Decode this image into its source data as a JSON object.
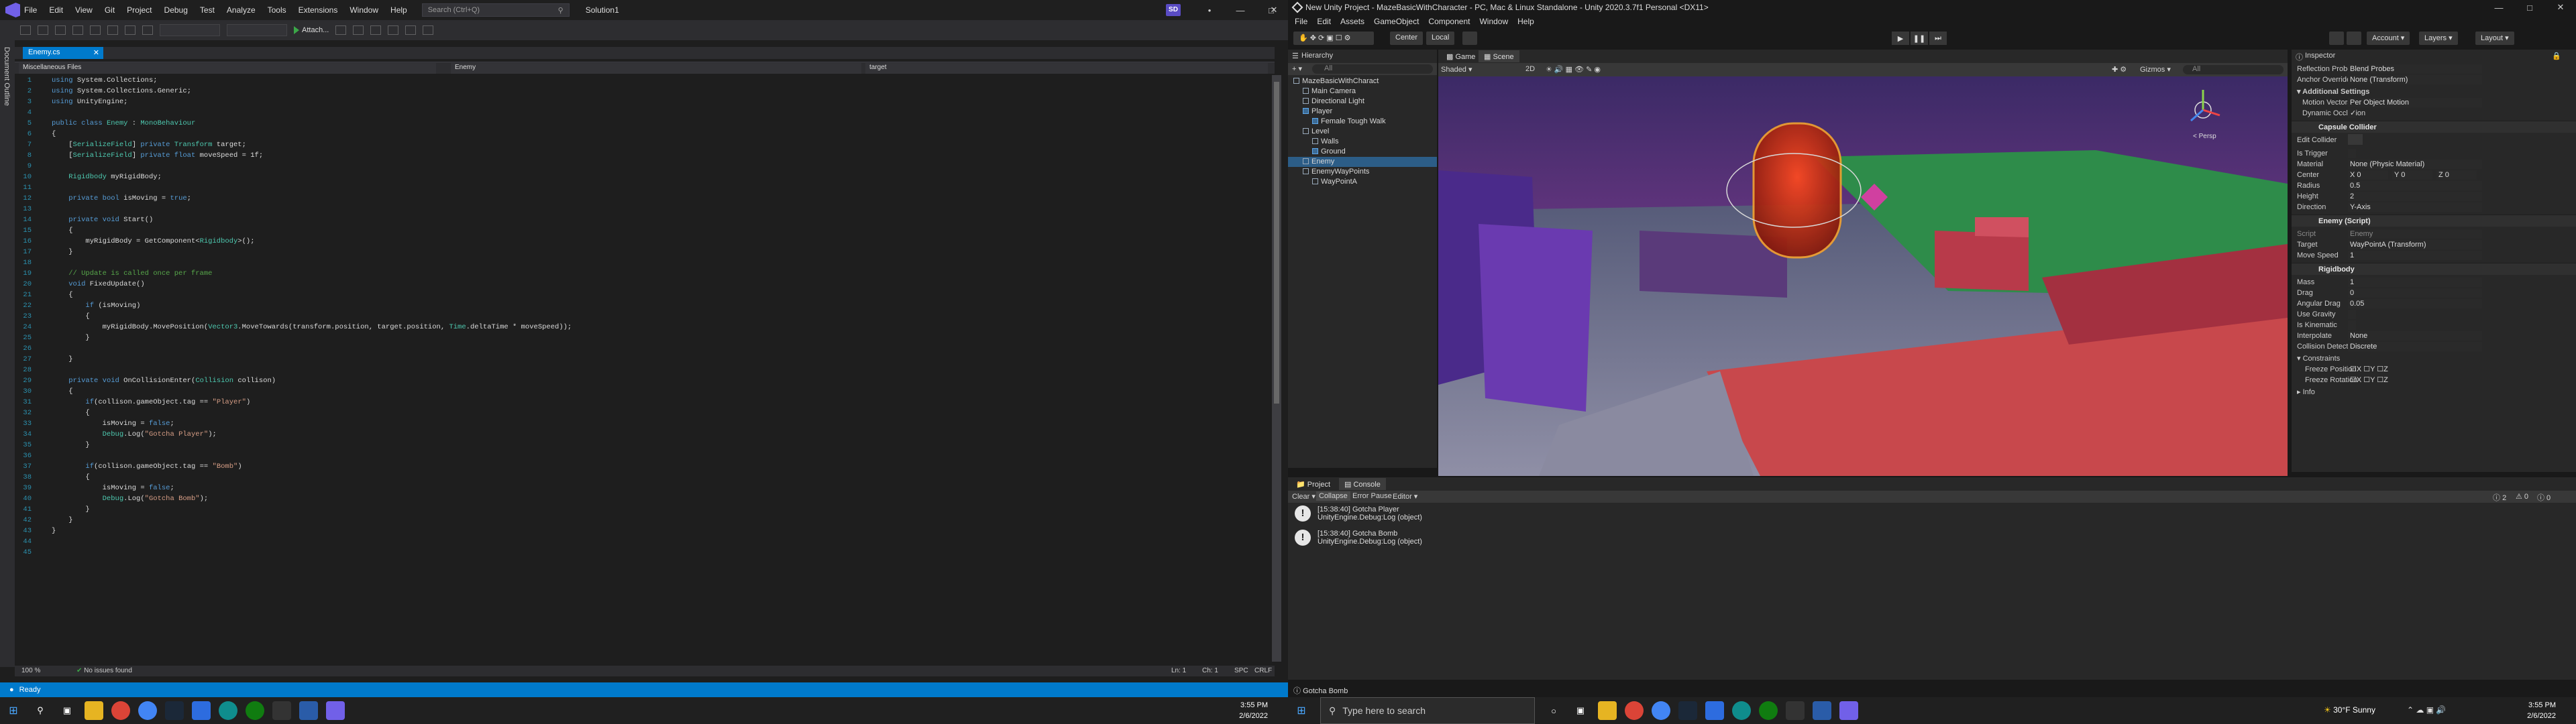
{
  "vs": {
    "menu": [
      "File",
      "Edit",
      "View",
      "Git",
      "Project",
      "Debug",
      "Test",
      "Analyze",
      "Tools",
      "Extensions",
      "Window",
      "Help"
    ],
    "search_placeholder": "Search (Ctrl+Q)",
    "solution_name": "Solution1",
    "user_initials": "SD",
    "attach_label": "Attach...",
    "doc_tab": "Enemy.cs",
    "side_label": "Document Outline",
    "nav": {
      "project": "Miscellaneous Files",
      "class": "Enemy",
      "member": "target"
    },
    "code_lines": [
      {
        "n": "1",
        "t": "using System.Collections;"
      },
      {
        "n": "2",
        "t": "using System.Collections.Generic;"
      },
      {
        "n": "3",
        "t": "using UnityEngine;"
      },
      {
        "n": "4",
        "t": ""
      },
      {
        "n": "5",
        "t": "public class Enemy : MonoBehaviour"
      },
      {
        "n": "6",
        "t": "{"
      },
      {
        "n": "7",
        "t": "    [SerializeField] private Transform target;"
      },
      {
        "n": "8",
        "t": "    [SerializeField] private float moveSpeed = 1f;"
      },
      {
        "n": "9",
        "t": ""
      },
      {
        "n": "10",
        "t": "    Rigidbody myRigidBody;"
      },
      {
        "n": "11",
        "t": ""
      },
      {
        "n": "12",
        "t": "    private bool isMoving = true;"
      },
      {
        "n": "13",
        "t": ""
      },
      {
        "n": "14",
        "t": "    private void Start()"
      },
      {
        "n": "15",
        "t": "    {"
      },
      {
        "n": "16",
        "t": "        myRigidBody = GetComponent<Rigidbody>();"
      },
      {
        "n": "17",
        "t": "    }"
      },
      {
        "n": "18",
        "t": ""
      },
      {
        "n": "19",
        "t": "    // Update is called once per frame"
      },
      {
        "n": "20",
        "t": "    void FixedUpdate()"
      },
      {
        "n": "21",
        "t": "    {"
      },
      {
        "n": "22",
        "t": "        if (isMoving)"
      },
      {
        "n": "23",
        "t": "        {"
      },
      {
        "n": "24",
        "t": "            myRigidBody.MovePosition(Vector3.MoveTowards(transform.position, target.position, Time.deltaTime * moveSpeed));"
      },
      {
        "n": "25",
        "t": "        }"
      },
      {
        "n": "26",
        "t": ""
      },
      {
        "n": "27",
        "t": "    }"
      },
      {
        "n": "28",
        "t": ""
      },
      {
        "n": "29",
        "t": "    private void OnCollisionEnter(Collision collison)"
      },
      {
        "n": "30",
        "t": "    {"
      },
      {
        "n": "31",
        "t": "        if(collison.gameObject.tag == \"Player\")"
      },
      {
        "n": "32",
        "t": "        {"
      },
      {
        "n": "33",
        "t": "            isMoving = false;"
      },
      {
        "n": "34",
        "t": "            Debug.Log(\"Gotcha Player\");"
      },
      {
        "n": "35",
        "t": "        }"
      },
      {
        "n": "36",
        "t": ""
      },
      {
        "n": "37",
        "t": "        if(collison.gameObject.tag == \"Bomb\")"
      },
      {
        "n": "38",
        "t": "        {"
      },
      {
        "n": "39",
        "t": "            isMoving = false;"
      },
      {
        "n": "40",
        "t": "            Debug.Log(\"Gotcha Bomb\");"
      },
      {
        "n": "41",
        "t": "        }"
      },
      {
        "n": "42",
        "t": "    }"
      },
      {
        "n": "43",
        "t": "}"
      },
      {
        "n": "44",
        "t": ""
      },
      {
        "n": "45",
        "t": ""
      }
    ],
    "zoom": "100 %",
    "issues": "No issues found",
    "ln": "Ln: 1",
    "ch": "Ch: 1",
    "spc": "SPC",
    "crlf": "CRLF",
    "status": "Ready"
  },
  "unity": {
    "title": "New Unity Project - MazeBasicWithCharacter - PC, Mac & Linux Standalone - Unity 2020.3.7f1 Personal <DX11>",
    "menu": [
      "File",
      "Edit",
      "Assets",
      "GameObject",
      "Component",
      "Window",
      "Help"
    ],
    "toolbar": {
      "center": "Center",
      "local": "Local",
      "account": "Account",
      "layers": "Layers",
      "layout": "Layout"
    },
    "hierarchy": {
      "title": "Hierarchy",
      "search": "All",
      "items": [
        {
          "label": "MazeBasicWithCharact",
          "ind": 0,
          "type": "scene"
        },
        {
          "label": "Main Camera",
          "ind": 1,
          "type": "go"
        },
        {
          "label": "Directional Light",
          "ind": 1,
          "type": "go"
        },
        {
          "label": "Player",
          "ind": 1,
          "type": "prefab"
        },
        {
          "label": "Female Tough Walk",
          "ind": 2,
          "type": "prefab"
        },
        {
          "label": "Level",
          "ind": 1,
          "type": "go"
        },
        {
          "label": "Walls",
          "ind": 2,
          "type": "go"
        },
        {
          "label": "Ground",
          "ind": 2,
          "type": "prefab"
        },
        {
          "label": "Enemy",
          "ind": 1,
          "type": "go",
          "sel": true
        },
        {
          "label": "EnemyWayPoints",
          "ind": 1,
          "type": "go"
        },
        {
          "label": "WayPointA",
          "ind": 2,
          "type": "go"
        }
      ]
    },
    "scene": {
      "tab_game": "Game",
      "tab_scene": "Scene",
      "shading": "Shaded",
      "mode": "2D",
      "gizmos": "Gizmos",
      "search": "All",
      "persp": "< Persp"
    },
    "inspector": {
      "title": "Inspector",
      "rows_top": [
        {
          "k": "Reflection Probes",
          "v": "Blend Probes"
        },
        {
          "k": "Anchor Override",
          "v": "None (Transform)"
        }
      ],
      "additional": "Additional Settings",
      "motion": {
        "k": "Motion Vectors",
        "v": "Per Object Motion"
      },
      "dyn": "Dynamic Occlusion",
      "capsule": {
        "title": "Capsule Collider",
        "edit": "Edit Collider",
        "trigger": "Is Trigger",
        "material": {
          "k": "Material",
          "v": "None (Physic Material)"
        },
        "center": {
          "k": "Center",
          "x": "0",
          "y": "0",
          "z": "0"
        },
        "radius": {
          "k": "Radius",
          "v": "0.5"
        },
        "height": {
          "k": "Height",
          "v": "2"
        },
        "direction": {
          "k": "Direction",
          "v": "Y-Axis"
        }
      },
      "enemy": {
        "title": "Enemy (Script)",
        "script": {
          "k": "Script",
          "v": "Enemy"
        },
        "target": {
          "k": "Target",
          "v": "WayPointA (Transform)"
        },
        "speed": {
          "k": "Move Speed",
          "v": "1"
        }
      },
      "rigidbody": {
        "title": "Rigidbody",
        "rows": [
          {
            "k": "Mass",
            "v": "1"
          },
          {
            "k": "Drag",
            "v": "0"
          },
          {
            "k": "Angular Drag",
            "v": "0.05"
          },
          {
            "k": "Use Gravity",
            "v": ""
          },
          {
            "k": "Is Kinematic",
            "v": ""
          },
          {
            "k": "Interpolate",
            "v": "None"
          },
          {
            "k": "Collision Detection",
            "v": "Discrete"
          }
        ],
        "constraints": "Constraints",
        "freeze_pos": "Freeze Position",
        "freeze_rot": "Freeze Rotation",
        "info": "Info"
      }
    },
    "console": {
      "tab_project": "Project",
      "tab_console": "Console",
      "clear": "Clear",
      "collapse": "Collapse",
      "error_pause": "Error Pause",
      "editor": "Editor",
      "count": "2",
      "logs": [
        {
          "l1": "[15:38:40] Gotcha Player",
          "l2": "UnityEngine.Debug:Log (object)"
        },
        {
          "l1": "[15:38:40] Gotcha Bomb",
          "l2": "UnityEngine.Debug:Log (object)"
        }
      ]
    },
    "status": "Gotcha Bomb"
  },
  "taskbar": {
    "search": "Type here to search",
    "weather": "30°F  Sunny",
    "time": "3:55 PM",
    "date": "2/6/2022"
  }
}
